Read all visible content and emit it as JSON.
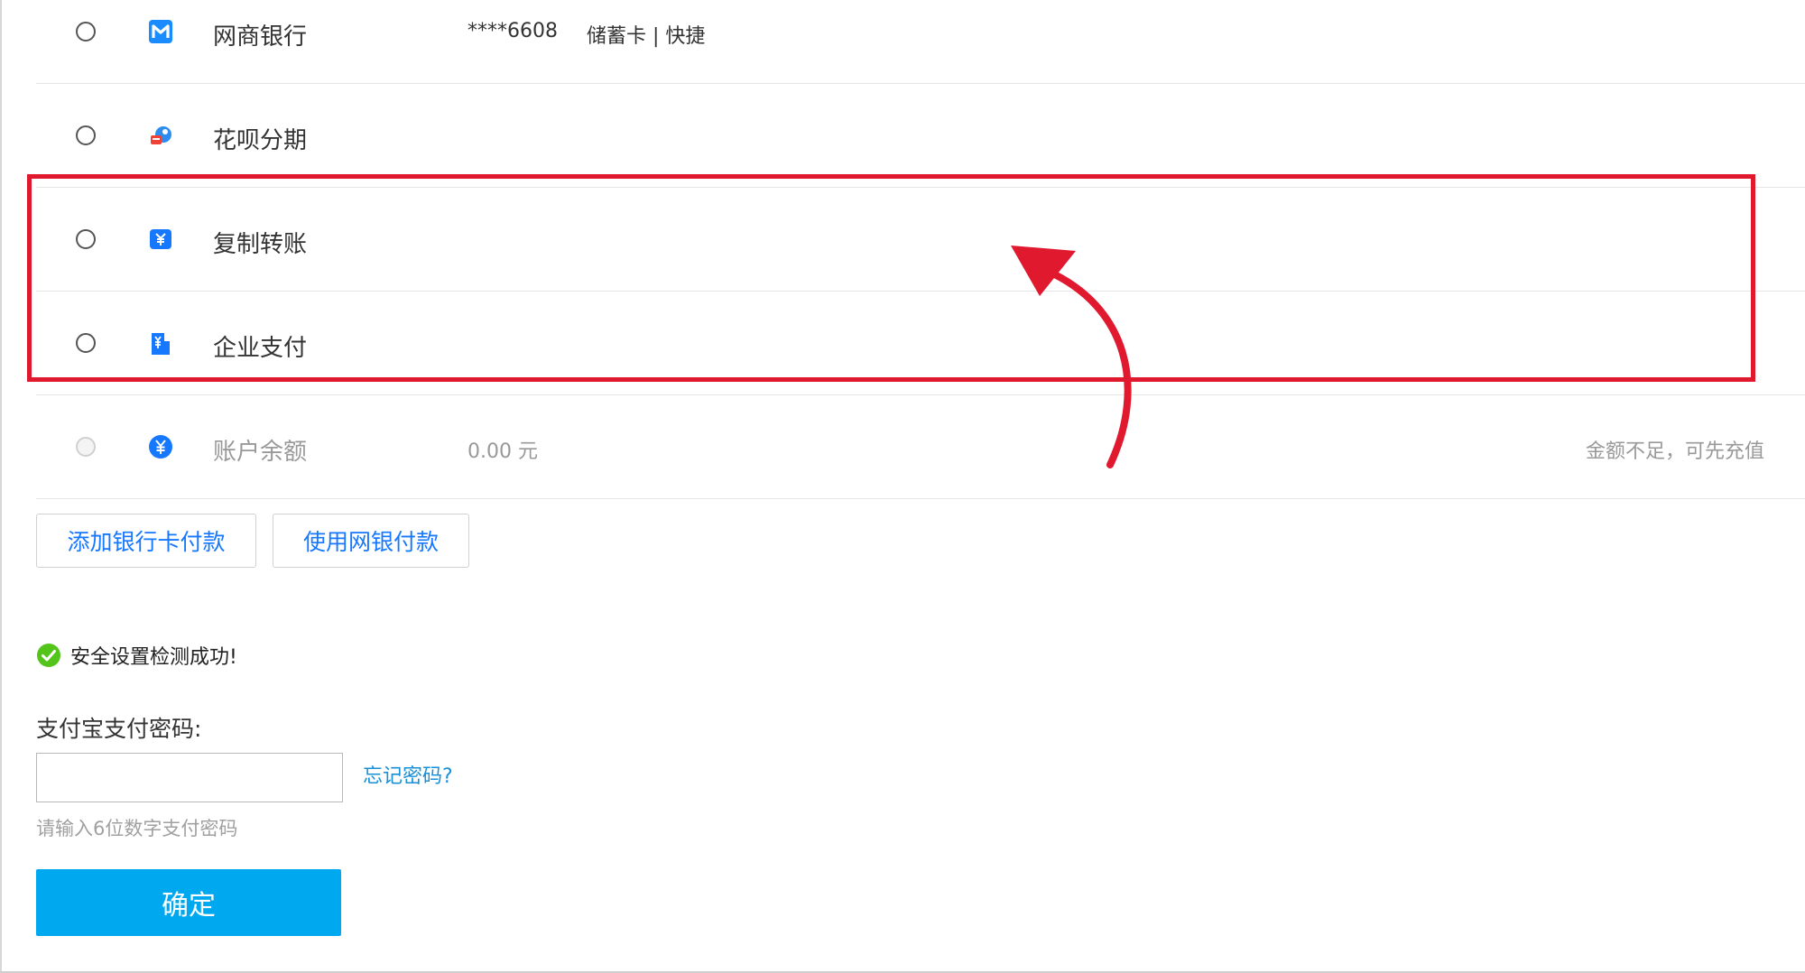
{
  "payment_methods": [
    {
      "name": "网商银行",
      "account": "****6608",
      "tag": "储蓄卡 | 快捷",
      "icon": "mybank-icon",
      "disabled": false
    },
    {
      "name": "花呗分期",
      "icon": "huabei-icon",
      "disabled": false
    },
    {
      "name": "复制转账",
      "icon": "transfer-icon",
      "disabled": false
    },
    {
      "name": "企业支付",
      "icon": "enterprise-pay-icon",
      "disabled": false
    },
    {
      "name": "账户余额",
      "amount": "0.00 元",
      "note": "金额不足，可先充值",
      "icon": "balance-icon",
      "disabled": true
    }
  ],
  "actions": {
    "add_bank_card": "添加银行卡付款",
    "use_netbank": "使用网银付款"
  },
  "security": {
    "status_text": "安全设置检测成功!"
  },
  "password": {
    "label": "支付宝支付密码:",
    "value": "",
    "forgot": "忘记密码?",
    "hint": "请输入6位数字支付密码"
  },
  "confirm_label": "确定",
  "colors": {
    "link_blue": "#1677ff",
    "confirm_bg": "#00a9ef",
    "highlight_red": "#e0192f",
    "success_green": "#52c41a"
  }
}
